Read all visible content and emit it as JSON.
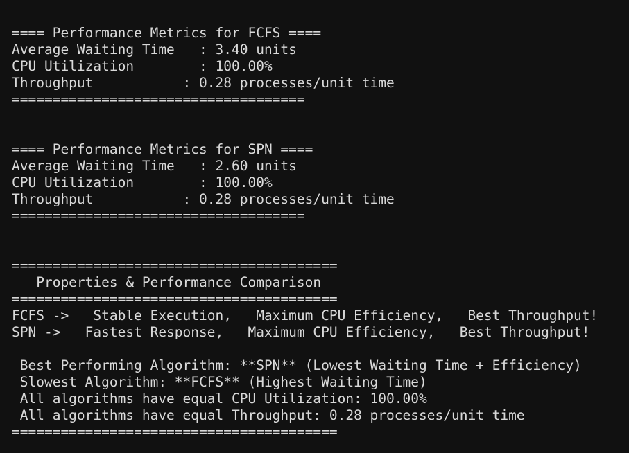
{
  "terminal": {
    "background": "#111111",
    "foreground": "#d9d9d9",
    "lines": [
      "==== Performance Metrics for FCFS ====",
      "Average Waiting Time   : 3.40 units",
      "CPU Utilization        : 100.00%",
      "Throughput           : 0.28 processes/unit time",
      "====================================",
      "",
      "",
      "==== Performance Metrics for SPN ====",
      "Average Waiting Time   : 2.60 units",
      "CPU Utilization        : 100.00%",
      "Throughput           : 0.28 processes/unit time",
      "====================================",
      "",
      "",
      "========================================",
      "   Properties & Performance Comparison",
      "========================================",
      "FCFS ->   Stable Execution,   Maximum CPU Efficiency,   Best Throughput!",
      "SPN ->   Fastest Response,   Maximum CPU Efficiency,   Best Throughput!",
      "",
      " Best Performing Algorithm: **SPN** (Lowest Waiting Time + Efficiency)",
      " Slowest Algorithm: **FCFS** (Highest Waiting Time)",
      " All algorithms have equal CPU Utilization: 100.00%",
      " All algorithms have equal Throughput: 0.28 processes/unit time",
      "========================================"
    ]
  }
}
